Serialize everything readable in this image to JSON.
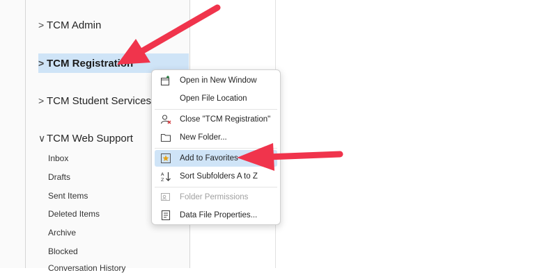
{
  "folders": [
    {
      "label": "TCM Admin",
      "chevron": ">",
      "selected": false
    },
    {
      "label": "TCM Registration",
      "chevron": ">",
      "selected": true
    },
    {
      "label": "TCM Student Services",
      "chevron": ">",
      "selected": false
    },
    {
      "label": "TCM Web Support",
      "chevron": "∨",
      "selected": false
    }
  ],
  "subfolders": [
    "Inbox",
    "Drafts",
    "Sent Items",
    "Deleted Items",
    "Archive",
    "Blocked",
    "Conversation History"
  ],
  "context_menu": {
    "items": [
      {
        "label": "Open in New Window",
        "icon": "new-window-icon",
        "disabled": false,
        "highlight": false
      },
      {
        "label": "Open File Location",
        "icon": "",
        "disabled": false,
        "highlight": false
      },
      {
        "label": "Close \"TCM Registration\"",
        "icon": "close-person-icon",
        "disabled": false,
        "highlight": false
      },
      {
        "label": "New Folder...",
        "icon": "folder-icon",
        "disabled": false,
        "highlight": false
      },
      {
        "label": "Add to Favorites",
        "icon": "favorites-star-icon",
        "disabled": false,
        "highlight": true
      },
      {
        "label": "Sort Subfolders A to Z",
        "icon": "sort-az-icon",
        "disabled": false,
        "highlight": false
      },
      {
        "label": "Folder Permissions",
        "icon": "permissions-icon",
        "disabled": true,
        "highlight": false
      },
      {
        "label": "Data File Properties...",
        "icon": "properties-icon",
        "disabled": false,
        "highlight": false
      }
    ]
  },
  "colors": {
    "selection": "#cfe4f7",
    "annotation_arrow": "#f0344c",
    "pane_background": "#fafafa",
    "disabled_text": "#a0a0a0"
  }
}
